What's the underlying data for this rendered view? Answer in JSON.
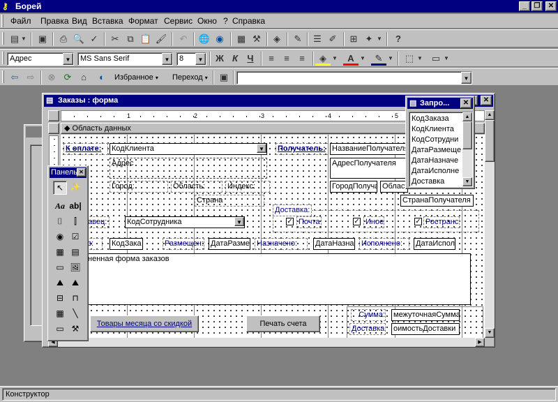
{
  "app": {
    "title": "Борей"
  },
  "menu": [
    "Файл",
    "Правка",
    "Вид",
    "Вставка",
    "Формат",
    "Сервис",
    "Окно",
    "?",
    "Справка"
  ],
  "format_toolbar": {
    "object_select": "Адрес",
    "font_name": "MS Sans Serif",
    "font_size": "8",
    "bold": "Ж",
    "italic": "К",
    "underline": "Ч"
  },
  "web_toolbar": {
    "favorites": "Избранное",
    "go": "Переход",
    "address": ""
  },
  "form_window": {
    "title": "Заказы : форма",
    "ruler_marks": [
      "1",
      "2",
      "3",
      "4",
      "5"
    ],
    "section_label": "Область данных",
    "controls": {
      "k_oplate": "К оплате:",
      "kod_klienta": "КодКлиента",
      "adres_lbl": "Адрес",
      "gorod_lbl": "Город:",
      "oblast_lbl": "Область:",
      "indeks_lbl": "Индекс:",
      "strana_lbl": "Страна",
      "poluchatel_lbl": "Получатель:",
      "nazvanie_poluchatelya": "НазваниеПолучателя",
      "adres_poluchatelya": "АдресПолучателя",
      "gorod_poluchatelya": "ГородПолуча",
      "oblast_poluchatelya": "Област",
      "strana_poluchatelya": "СтранаПолучателя",
      "prodavec_lbl": "авец:",
      "kod_sotrudnika": "КодСотрудника",
      "dostavka_lbl": "Доставка:",
      "pochta": "Почта",
      "inoe": "Иное",
      "rostrans": "Ространс",
      "zakaz_lbl": "з:",
      "kod_zakaza": "КодЗака",
      "razmeshen_lbl": "Размещен:",
      "data_razmesheniya": "ДатаРазме",
      "naznacheno_lbl": "Назначено:",
      "data_naznacheniya": "ДатаНазна",
      "ispolneno_lbl": "Исполнено:",
      "data_ispolneniya": "ДатаИспол",
      "subform_caption": "ненная форма заказов",
      "tovary_btn": "Товары месяца со скидкой",
      "pechat_btn": "Печать счета",
      "summa_lbl": "Сумма:",
      "promezhutochnaya": "межуточнаяСумма]",
      "dostavka2_lbl": "Доставка",
      "stoimost_dostavki": "оимостьДоставки"
    }
  },
  "query_window": {
    "title": "Запро...",
    "fields": [
      "КодЗаказа",
      "КодКлиента",
      "КодСотрудни",
      "ДатаРазмеще",
      "ДатаНазначе",
      "ДатаИсполне",
      "Доставка"
    ]
  },
  "toolbox": {
    "title": "Панель",
    "items": [
      "select-tool",
      "wizard-tool",
      "label-tool",
      "textbox-tool",
      "option-group-tool",
      "toggle-tool",
      "option-tool",
      "checkbox-tool",
      "combo-tool",
      "list-tool",
      "button-tool",
      "image-tool",
      "unbound-frame-tool",
      "bound-frame-tool",
      "page-break-tool",
      "tab-tool",
      "subform-tool",
      "line-tool",
      "rectangle-tool",
      "more-tools"
    ]
  },
  "status": {
    "text": "Конструктор"
  },
  "colors": {
    "title_active": "#000080",
    "face": "#c0c0c0",
    "desktop": "#808080"
  }
}
